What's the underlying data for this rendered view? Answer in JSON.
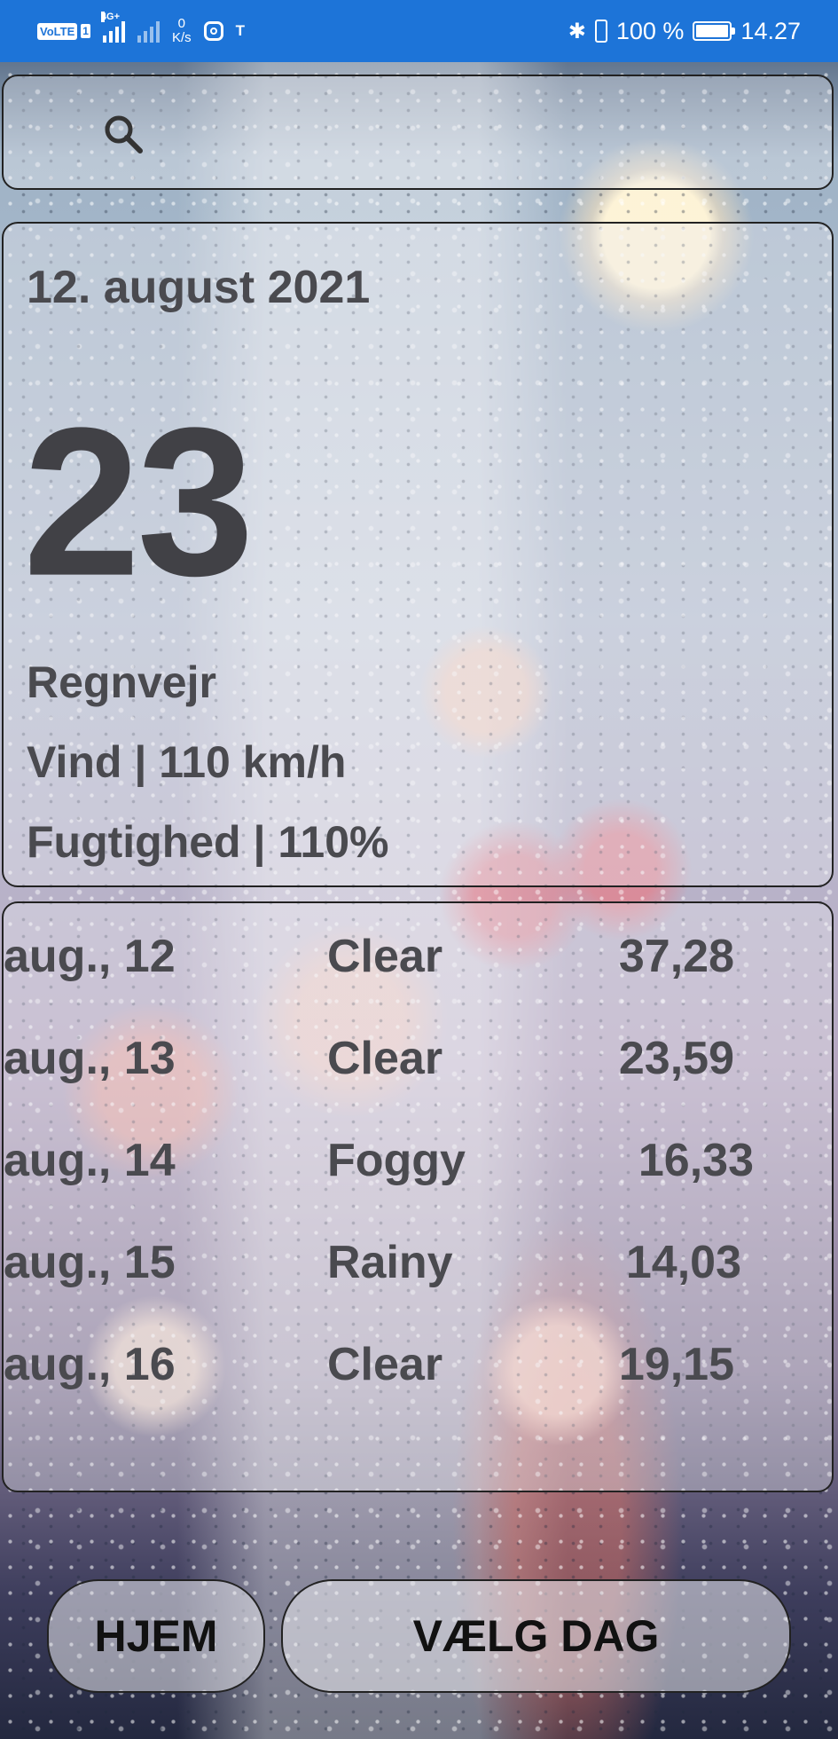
{
  "status_bar": {
    "volte": "VoLTE",
    "sim": "1",
    "network": "4G+",
    "speed_value": "0",
    "speed_unit": "K/s",
    "teams": "T",
    "battery_percent": "100 %",
    "time": "14.27"
  },
  "search": {
    "placeholder": "",
    "value": ""
  },
  "today": {
    "date": "12. august 2021",
    "temperature": "23",
    "condition": "Regnvejr",
    "wind": "Vind | 110 km/h",
    "humidity": "Fugtighed | 110%"
  },
  "forecast": [
    {
      "date": "aug., 12",
      "condition": "Clear",
      "value": "37,28"
    },
    {
      "date": "aug., 13",
      "condition": "Clear",
      "value": "23,59"
    },
    {
      "date": "aug., 14",
      "condition": "Foggy",
      "value": "16,33"
    },
    {
      "date": "aug., 15",
      "condition": "Rainy",
      "value": "14,03"
    },
    {
      "date": "aug., 16",
      "condition": "Clear",
      "value": "19,15"
    }
  ],
  "buttons": {
    "home": "HJEM",
    "choose_day": "VÆLG DAG"
  }
}
